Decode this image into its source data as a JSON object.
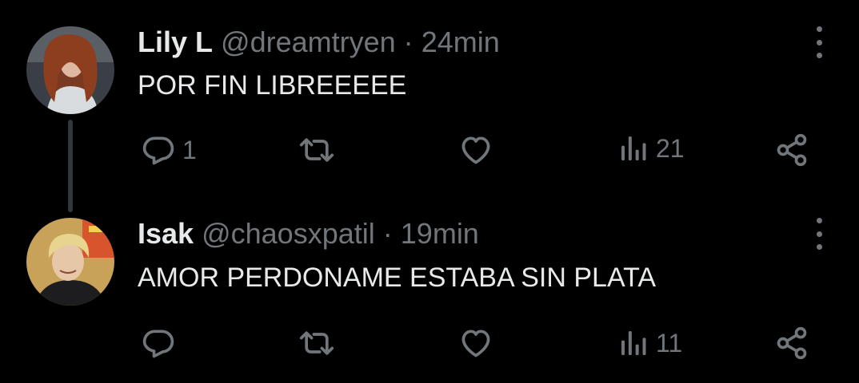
{
  "tweets": [
    {
      "name": "Lily L",
      "handle": "@dreamtryen",
      "separator": "·",
      "time": "24min",
      "text": "POR FIN LIBREEEEE",
      "reply_count": "1",
      "views_count": "21",
      "avatar_icon": "profile-photo-red-hair"
    },
    {
      "name": "Isak",
      "handle": "@chaosxpatil",
      "separator": "·",
      "time": "19min",
      "text": "AMOR PERDONAME ESTABA SIN PLATA",
      "reply_count": "",
      "views_count": "11",
      "avatar_icon": "profile-photo-blond-hair"
    }
  ],
  "colors": {
    "background": "#000000",
    "primary_text": "#e7e9ea",
    "secondary_text": "#71767b",
    "thread_line": "#333639"
  },
  "icons": [
    "reply-icon",
    "retweet-icon",
    "like-icon",
    "views-icon",
    "share-icon",
    "more-icon"
  ]
}
